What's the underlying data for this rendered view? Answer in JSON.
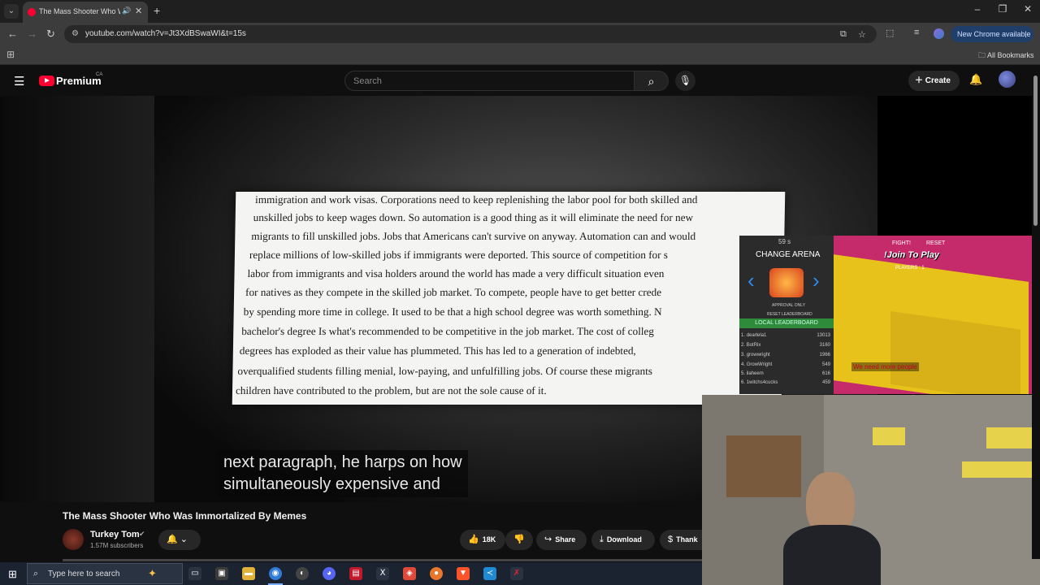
{
  "browser": {
    "tab_title": "The Mass Shooter Who Wa",
    "url": "youtube.com/watch?v=Jt3XdBSwaWI&t=15s",
    "new_chrome_label": "New Chrome available",
    "all_bookmarks_label": "All Bookmarks"
  },
  "youtube": {
    "logo_text": "Premium",
    "country_code": "CA",
    "search_placeholder": "Search",
    "create_label": "Create"
  },
  "video": {
    "document_lines": [
      "immigration and work visas. Corporations need to keep replenishing the labor pool for both skilled and",
      "unskilled jobs to keep wages down. So automation is a good thing as it will eliminate the need for new",
      "migrants to fill unskilled jobs. Jobs that Americans can't survive on anyway. Automation can and would",
      "replace millions of low-skilled jobs if immigrants were deported. This source of competition for s",
      "labor from immigrants and visa holders around the world has made a very difficult situation even",
      "for natives as they compete in the skilled job market. To compete, people have to get better crede",
      "by spending more time in college. It used to be that a high school degree was worth something. N",
      "bachelor's degree Is what's recommended to be competitive in the job market. The cost of colleg",
      "degrees has exploded as their value has plummeted. This has led to a generation of indebted,",
      "overqualified students filling menial, low-paying, and unfulfilling jobs. Of course these migrants",
      "children have contributed to the problem, but are not the sole cause of it."
    ],
    "caption_line1": "next paragraph, he harps on how",
    "caption_line2": "simultaneously expensive and"
  },
  "game_overlay": {
    "timer": "59 s",
    "change_arena_label": "CHANGE ARENA",
    "approval_label": "APPROVAL ONLY",
    "reset_leaderboard_label": "RESET LEADERBOARD",
    "local_leaderboard_label": "LOCAL LEADERBOARD",
    "fight_label": "FIGHT!",
    "reset_label": "RESET",
    "join_label": "!Join To Play",
    "players_label": "PLAYERS : 1",
    "chat_message": "We need more people",
    "leaderboard": [
      {
        "rank": "1.",
        "name": "dearlela1",
        "score": "13013"
      },
      {
        "rank": "2.",
        "name": "BotRix",
        "score": "3160"
      },
      {
        "rank": "3.",
        "name": "growwright",
        "score": "1966"
      },
      {
        "rank": "4.",
        "name": "GrowWright",
        "score": "549"
      },
      {
        "rank": "5.",
        "name": "ilaheem",
        "score": "616"
      },
      {
        "rank": "6.",
        "name": "1witchs4cucks",
        "score": "459"
      }
    ]
  },
  "video_info": {
    "title": "The Mass Shooter Who Was Immortalized By Memes",
    "channel_name": "Turkey Tom",
    "subscribers": "1.57M subscribers",
    "likes": "18K",
    "share_label": "Share",
    "download_label": "Download",
    "thanks_label": "Thank"
  },
  "taskbar": {
    "search_placeholder": "Type here to search"
  },
  "colors": {
    "youtube_red": "#ff0033",
    "leaderboard_green": "#2e8b3a",
    "arena_yellow": "#e7c21a",
    "arena_pink": "#c52a6b"
  },
  "icons": [
    "chevron-down-icon",
    "speaker-icon",
    "close-icon",
    "plus-icon",
    "minimize-icon",
    "restore-icon",
    "back-icon",
    "forward-icon",
    "reload-icon",
    "site-info-icon",
    "install-icon",
    "star-icon",
    "extensions-icon",
    "reading-list-icon",
    "apps-icon",
    "folder-icon",
    "menu-icon",
    "search-icon",
    "mic-icon",
    "bell-icon",
    "like-icon",
    "dislike-icon",
    "share-icon",
    "download-icon",
    "thanks-icon",
    "windows-icon"
  ]
}
